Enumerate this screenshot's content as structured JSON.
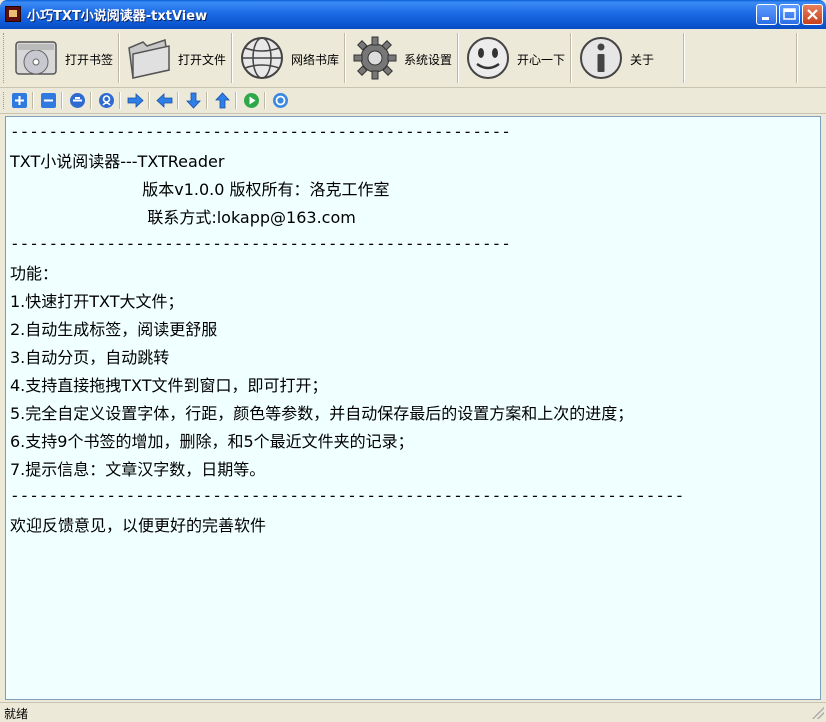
{
  "window": {
    "title": "小巧TXT小说阅读器-txtView",
    "minimize": "_",
    "maximize": "□",
    "close": "✕"
  },
  "toolbar": {
    "buttons": [
      {
        "label": "打开书签",
        "icon": "bookmark-cd-icon"
      },
      {
        "label": "打开文件",
        "icon": "folder-icon"
      },
      {
        "label": "网络书库",
        "icon": "globe-icon"
      },
      {
        "label": "系统设置",
        "icon": "gear-icon"
      },
      {
        "label": "开心一下",
        "icon": "smiley-face-icon"
      },
      {
        "label": "关于",
        "icon": "info-icon"
      }
    ]
  },
  "toolbar2": {
    "icons": [
      "zoom-in-icon",
      "zoom-out-icon",
      "up-circle-icon",
      "down-circle-icon",
      "arrow-right-icon",
      "arrow-left-icon",
      "arrow-down-icon",
      "arrow-up-icon",
      "play-icon",
      "refresh-icon"
    ]
  },
  "content": {
    "lines": [
      "----------------------------------------------------",
      "TXT小说阅读器---TXTReader",
      "                          版本v1.0.0 版权所有：洛克工作室",
      "                           联系方式:lokapp@163.com",
      "----------------------------------------------------",
      "功能：",
      "1.快速打开TXT大文件；",
      "2.自动生成标签，阅读更舒服",
      "3.自动分页，自动跳转",
      "4.支持直接拖拽TXT文件到窗口，即可打开；",
      "5.完全自定义设置字体，行距，颜色等参数，并自动保存最后的设置方案和上次的进度；",
      "6.支持9个书签的增加，删除，和5个最近文件夹的记录；",
      "7.提示信息：文章汉字数，日期等。",
      "----------------------------------------------------------------------",
      "欢迎反馈意见，以便更好的完善软件"
    ]
  },
  "statusbar": {
    "text": "就绪"
  },
  "colors": {
    "content_bg": "#f0ffff",
    "titlebar": "#0b55d0",
    "toolbar_bg": "#ece9d8"
  }
}
